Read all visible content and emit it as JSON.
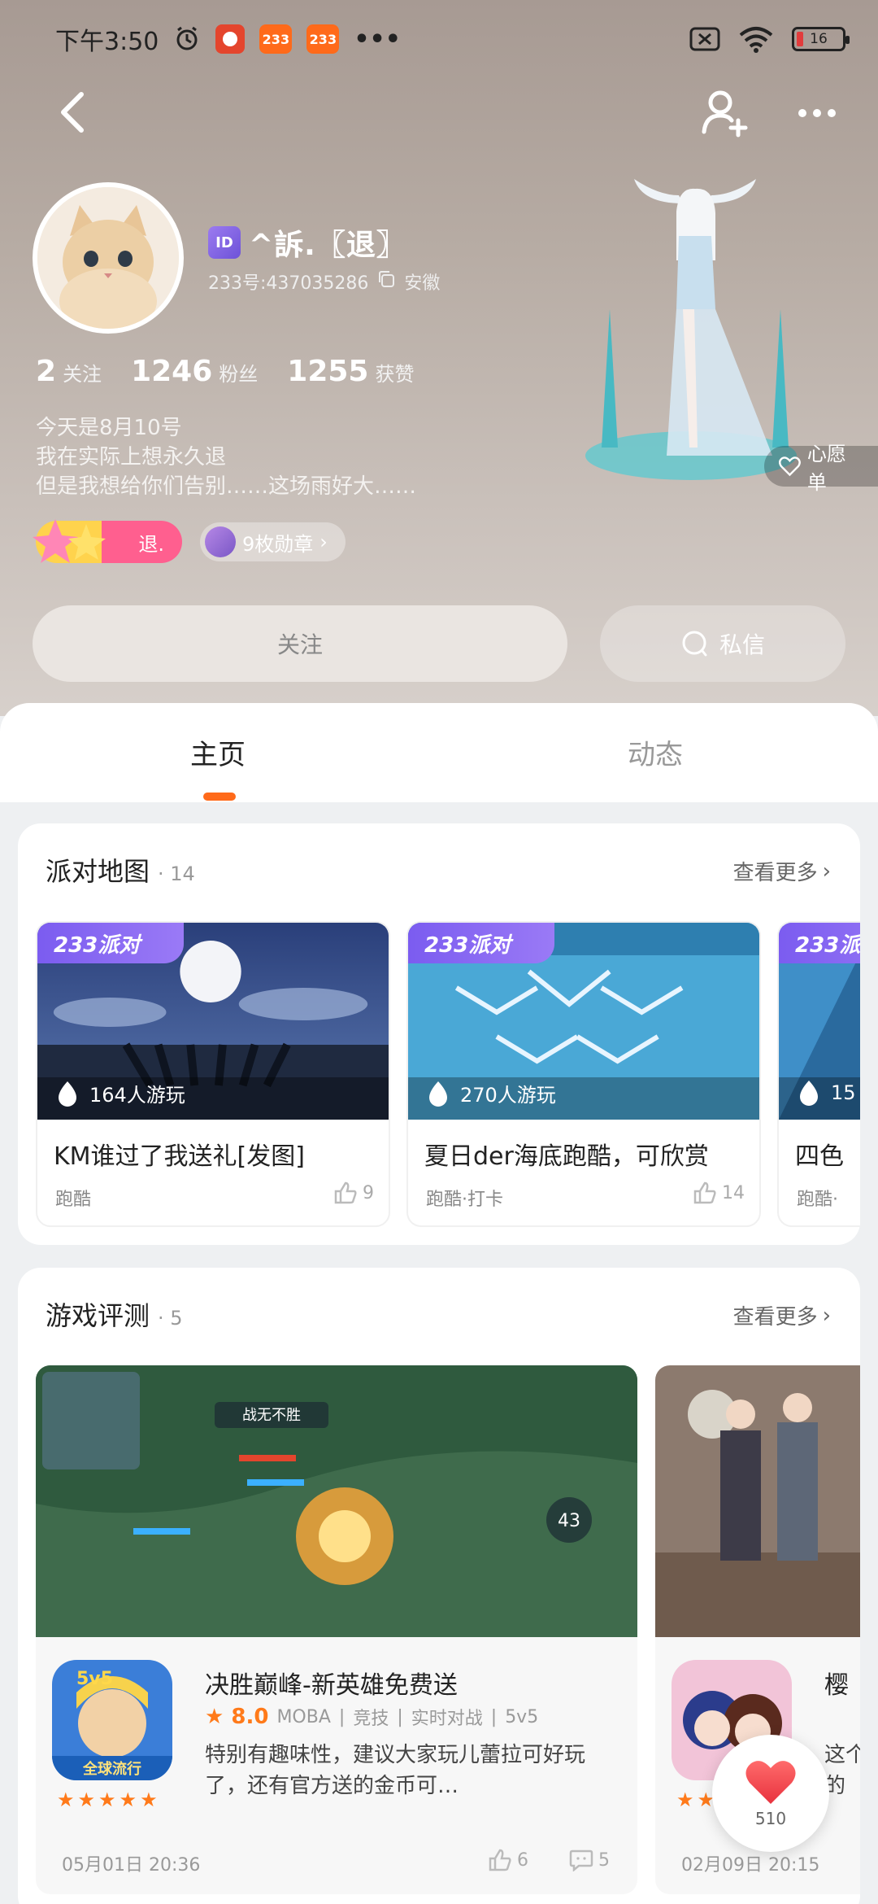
{
  "status_bar": {
    "time": "下午3:50",
    "app_badges": [
      "233",
      "233"
    ],
    "battery": "16",
    "colors": {
      "badge_red": "#e4452d",
      "badge_orange": "#ff6a1a"
    }
  },
  "profile": {
    "username": "^訴.〖退〗",
    "id_badge": "ID",
    "id_line": "233号:437035286",
    "location": "安徽",
    "stats": [
      {
        "num": "2",
        "label": "关注"
      },
      {
        "num": "1246",
        "label": "粉丝"
      },
      {
        "num": "1255",
        "label": "获赞"
      }
    ],
    "bio": [
      "今天是8月10号",
      "我在实际上想永久退",
      "但是我想给你们告别……这场雨好大……"
    ],
    "star_badge": "退.",
    "medals": "9枚勋章",
    "wish_list": "心愿单",
    "follow_label": "关注",
    "message_label": "私信"
  },
  "tabs": {
    "home": "主页",
    "feed": "动态",
    "accent": "#ff6a1a"
  },
  "party_section": {
    "title": "派对地图",
    "count": "14",
    "more": "查看更多",
    "tag": "233派对",
    "items": [
      {
        "players": "164人游玩",
        "name": "KM谁过了我送礼[发图]",
        "tags": "跑酷",
        "likes": "9"
      },
      {
        "players": "270人游玩",
        "name": "夏日der海底跑酷，可欣赏",
        "tags": "跑酷·打卡",
        "likes": "14"
      },
      {
        "players": "15",
        "name": "四色",
        "tags": "跑酷·",
        "likes": ""
      }
    ]
  },
  "review_section": {
    "title": "游戏评测",
    "count": "5",
    "more": "查看更多",
    "items": [
      {
        "game": "决胜巅峰-新英雄免费送",
        "rating": "8.0",
        "genres": [
          "MOBA",
          "竞技",
          "实时对战",
          "5v5"
        ],
        "text": "特别有趣味性，建议大家玩儿蕾拉可好玩了，还有官方送的金币可…",
        "stars": "★★★★★",
        "date": "05月01日 20:36",
        "likes": "6",
        "comments": "5",
        "shot_caption": "战无不胜",
        "shot_number": "43",
        "icon_top": "5v5",
        "icon_bottom": "全球流行"
      },
      {
        "game": "樱",
        "rating": "",
        "text": "这个把的",
        "stars": "★★",
        "date": "02月09日 20:15"
      }
    ]
  },
  "floating_like": {
    "count": "510"
  }
}
